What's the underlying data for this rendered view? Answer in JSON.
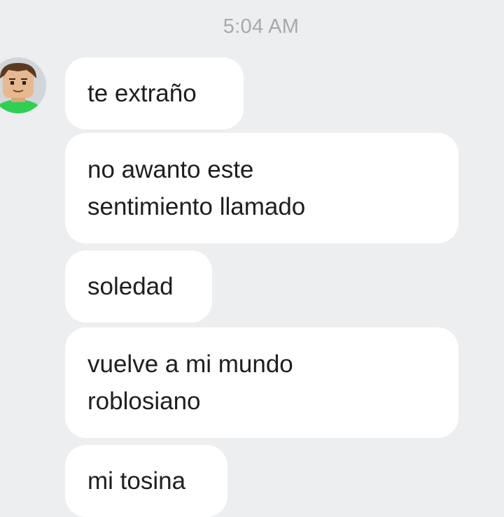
{
  "conversation": {
    "timestamp": "5:04 AM",
    "contact": {
      "avatar_icon": "roblox-avatar-icon",
      "avatar_colors": {
        "skin": "#e7b98f",
        "hair": "#5a3a22",
        "shirt": "#2fcf52",
        "background": "#d3d6d9"
      }
    },
    "messages": [
      {
        "text": "te extraño"
      },
      {
        "text": "no awanto este\nsentimiento llamado"
      },
      {
        "text": "soledad"
      },
      {
        "text": "vuelve a mi mundo\nroblosiano"
      },
      {
        "text": "mi tosina"
      }
    ]
  }
}
